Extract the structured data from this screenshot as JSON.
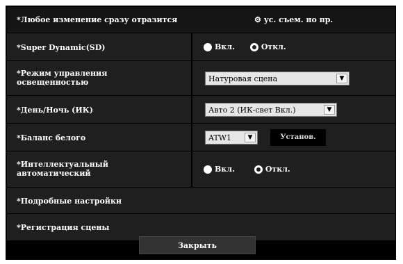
{
  "banner": {
    "note_left": "*Любое изменение сразу отразится",
    "note_right_icon": "gear-icon",
    "note_right": "ус. съем. но пр."
  },
  "rows": {
    "super_dynamic": {
      "label": "*Super Dynamic(SD)",
      "options": [
        {
          "label": "Вкл.",
          "selected": true
        },
        {
          "label": "Откл.",
          "selected": false
        }
      ]
    },
    "light_control": {
      "label_line1": "*Режим управления",
      "label_line2": "освещенностью",
      "value": "Натуровая сцена"
    },
    "day_night": {
      "label": "*День/Ночь (ИК)",
      "value": "Авто 2 (ИК-свет Вкл.)"
    },
    "white_balance": {
      "label": "*Баланс белого",
      "value": "ATW1",
      "set_button": "Установ."
    },
    "intelligent_auto": {
      "label_line1": "*Интеллектуальный",
      "label_line2": "автоматический",
      "options": [
        {
          "label": "Вкл.",
          "selected": true
        },
        {
          "label": "Откл.",
          "selected": false
        }
      ]
    },
    "advanced": {
      "label": "*Подробные настройки"
    },
    "scene": {
      "label": "*Регистрация сцены"
    }
  },
  "footer": {
    "close_label": "Закрыть"
  },
  "colors": {
    "panel_bg": "#1f1f1f",
    "frame_bg": "#000000",
    "select_bg": "#e6e6e6"
  }
}
